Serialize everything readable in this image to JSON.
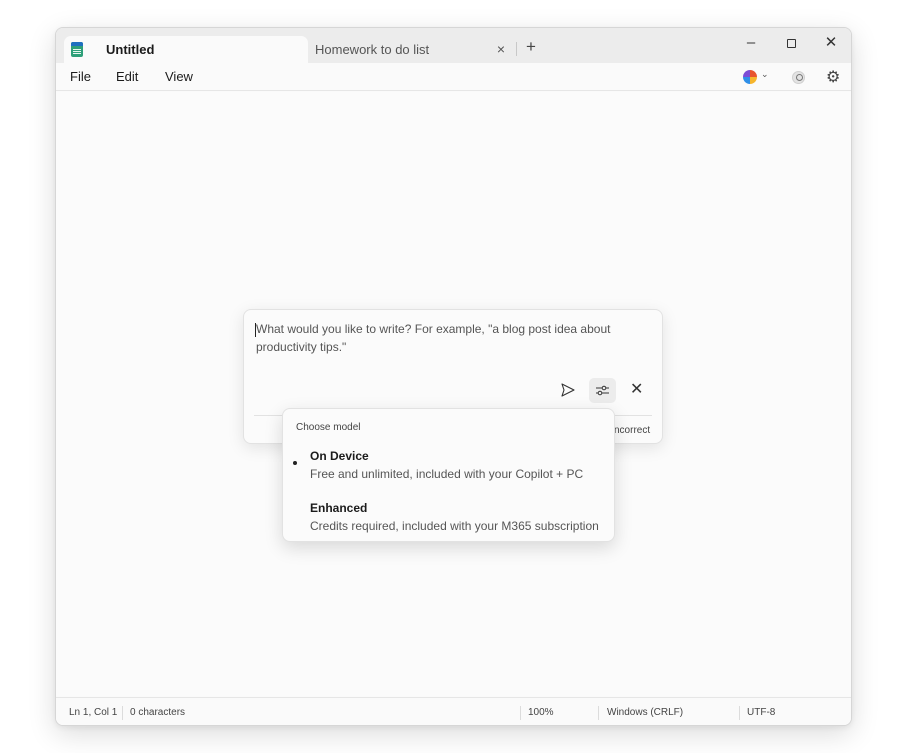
{
  "tabs": [
    {
      "title": "Untitled"
    },
    {
      "title": "Homework to do list",
      "close_label": "×"
    }
  ],
  "new_tab_label": "+",
  "window_controls": {
    "minimize": "–",
    "close": "✕"
  },
  "menu": {
    "file": "File",
    "edit": "Edit",
    "view": "View"
  },
  "toolbar_icons": [
    "copilot-icon",
    "account-icon",
    "gear-icon"
  ],
  "prompt": {
    "placeholder": "What would you like to write? For example, \"a blog post idea about productivity tips.\"",
    "footer_text": "ncorrect",
    "close_label": "✕"
  },
  "model_menu": {
    "header": "Choose model",
    "options": [
      {
        "title": "On Device",
        "description": "Free and unlimited, included with your Copilot + PC",
        "selected": true
      },
      {
        "title": "Enhanced",
        "description": "Credits required, included with your M365 subscription",
        "selected": false
      }
    ]
  },
  "status": {
    "position": "Ln 1, Col 1",
    "characters": "0 characters",
    "zoom": "100%",
    "line_ending": "Windows (CRLF)",
    "encoding": "UTF-8"
  }
}
